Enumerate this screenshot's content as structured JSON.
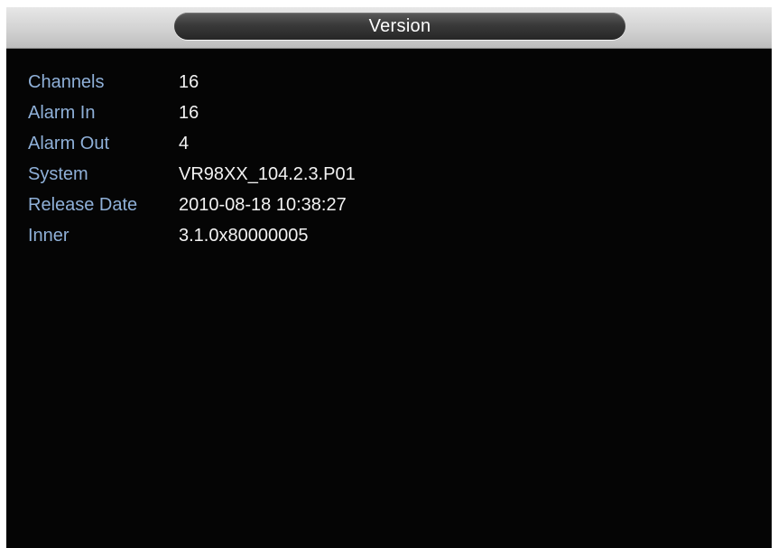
{
  "window": {
    "title": "Version"
  },
  "info": {
    "rows": [
      {
        "label": "Channels",
        "value": "16"
      },
      {
        "label": "Alarm In",
        "value": "16"
      },
      {
        "label": "Alarm Out",
        "value": "4"
      },
      {
        "label": "System",
        "value": "VR98XX_104.2.3.P01"
      },
      {
        "label": "Release Date",
        "value": "2010-08-18 10:38:27"
      },
      {
        "label": "Inner",
        "value": "3.1.0x80000005"
      }
    ]
  },
  "colors": {
    "background": "#050505",
    "label": "#8fb0d8",
    "value": "#f2f2f2",
    "title_text": "#ffffff"
  }
}
